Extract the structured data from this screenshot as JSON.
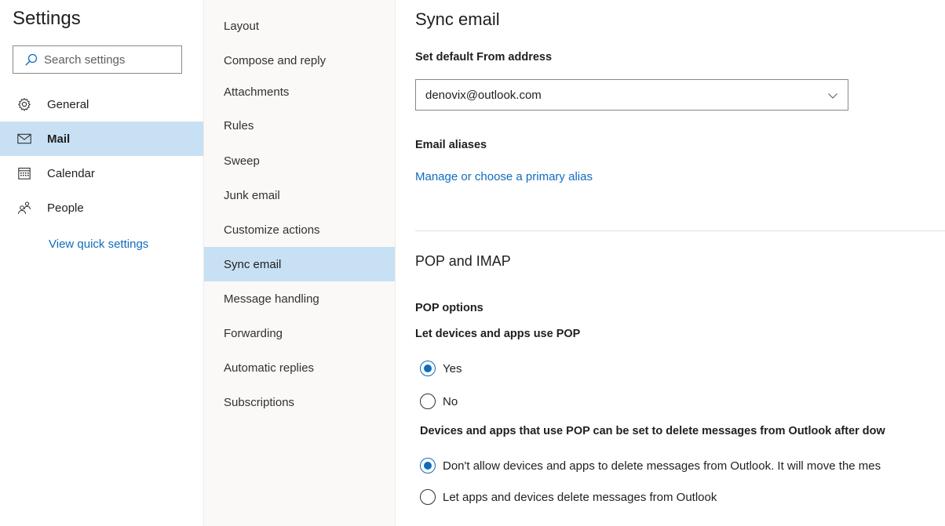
{
  "settings_panel": {
    "title": "Settings",
    "search_placeholder": "Search settings",
    "nav": [
      {
        "label": "General",
        "icon": "gear-icon"
      },
      {
        "label": "Mail",
        "icon": "mail-icon",
        "selected": true
      },
      {
        "label": "Calendar",
        "icon": "calendar-icon"
      },
      {
        "label": "People",
        "icon": "people-icon"
      }
    ],
    "quick_settings_link": "View quick settings"
  },
  "mail_subnav": [
    {
      "label": "Layout"
    },
    {
      "label": "Compose and reply"
    },
    {
      "label": "Attachments"
    },
    {
      "label": "Rules"
    },
    {
      "label": "Sweep"
    },
    {
      "label": "Junk email"
    },
    {
      "label": "Customize actions"
    },
    {
      "label": "Sync email",
      "selected": true
    },
    {
      "label": "Message handling"
    },
    {
      "label": "Forwarding"
    },
    {
      "label": "Automatic replies"
    },
    {
      "label": "Subscriptions"
    }
  ],
  "main": {
    "title": "Sync email",
    "default_from": {
      "label": "Set default From address",
      "value": "denovix@outlook.com"
    },
    "aliases": {
      "label": "Email aliases",
      "link": "Manage or choose a primary alias"
    },
    "pop_imap": {
      "title": "POP and IMAP",
      "pop_options_label": "POP options",
      "let_devices_label": "Let devices and apps use POP",
      "use_pop_options": [
        {
          "label": "Yes",
          "checked": true
        },
        {
          "label": "No",
          "checked": false
        }
      ],
      "delete_label": "Devices and apps that use POP can be set to delete messages from Outlook after dow",
      "delete_options": [
        {
          "label": "Don't allow devices and apps to delete messages from Outlook. It will move the mes",
          "checked": true
        },
        {
          "label": "Let apps and devices delete messages from Outlook",
          "checked": false
        }
      ]
    }
  },
  "colors": {
    "accent": "#0f6cbd",
    "selected_bg": "#c7e0f4",
    "subnav_bg": "#faf9f8"
  }
}
